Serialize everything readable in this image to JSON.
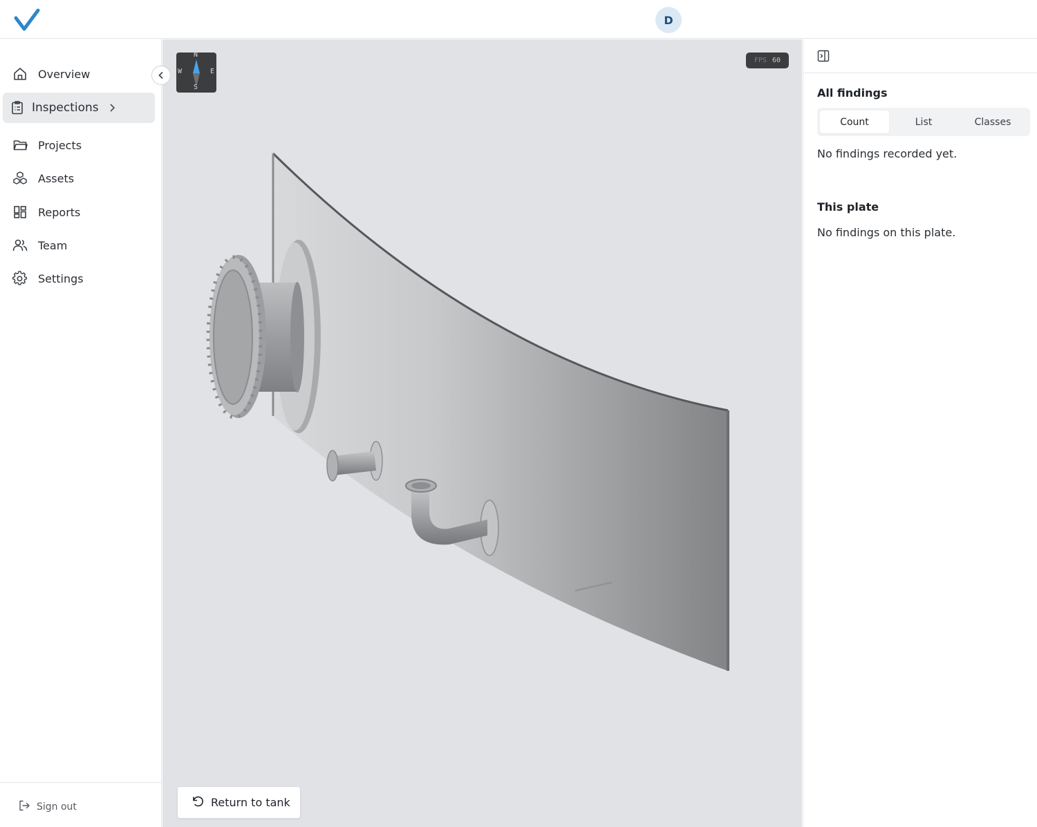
{
  "header": {
    "avatar_initial": "D"
  },
  "sidebar": {
    "items": [
      {
        "label": "Overview",
        "icon": "home-icon"
      },
      {
        "label": "Inspections",
        "icon": "clipboard-icon",
        "active": true
      },
      {
        "label": "Projects",
        "icon": "folder-icon"
      },
      {
        "label": "Assets",
        "icon": "cubes-icon"
      },
      {
        "label": "Reports",
        "icon": "grid-icon"
      },
      {
        "label": "Team",
        "icon": "users-icon"
      },
      {
        "label": "Settings",
        "icon": "gear-icon"
      }
    ],
    "sign_out_label": "Sign out"
  },
  "viewer": {
    "compass": {
      "n": "N",
      "s": "S",
      "e": "E",
      "w": "W"
    },
    "fps_label": "FPS",
    "fps_value": "60",
    "return_label": "Return to tank"
  },
  "findings_panel": {
    "all_title": "All findings",
    "tabs": [
      {
        "label": "Count",
        "selected": true
      },
      {
        "label": "List"
      },
      {
        "label": "Classes"
      }
    ],
    "all_empty": "No findings recorded yet.",
    "plate_title": "This plate",
    "plate_empty": "No findings on this plate."
  },
  "colors": {
    "brand": "#2f86c8",
    "active_nav": "#e9eaec",
    "viewport_bg": "#e1e2e5"
  }
}
